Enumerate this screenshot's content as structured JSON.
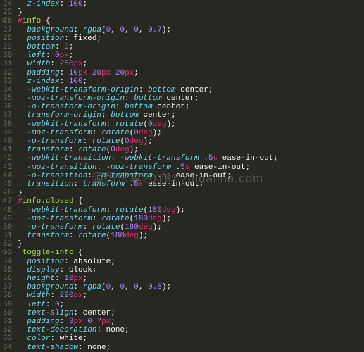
{
  "lines": [
    {
      "n": 24,
      "tokens": [
        [
          "  ",
          ""
        ],
        [
          "z-index",
          "prop"
        ],
        [
          ": ",
          "punct"
        ],
        [
          "100",
          "num"
        ],
        [
          ";",
          "punct"
        ]
      ]
    },
    {
      "n": 25,
      "tokens": [
        [
          "}",
          "punct"
        ]
      ]
    },
    {
      "n": 26,
      "fold": true,
      "tokens": [
        [
          "#",
          "hash"
        ],
        [
          "info",
          "selector"
        ],
        [
          " {",
          "punct"
        ]
      ]
    },
    {
      "n": 27,
      "tokens": [
        [
          "  ",
          ""
        ],
        [
          "background",
          "prop"
        ],
        [
          ": ",
          "punct"
        ],
        [
          "rgba",
          "func"
        ],
        [
          "(",
          "punct"
        ],
        [
          "0",
          "num"
        ],
        [
          ", ",
          "punct"
        ],
        [
          "0",
          "num"
        ],
        [
          ", ",
          "punct"
        ],
        [
          "0",
          "num"
        ],
        [
          ", ",
          "punct"
        ],
        [
          "0.7",
          "num"
        ],
        [
          ")",
          "punct"
        ],
        [
          ";",
          "punct"
        ]
      ]
    },
    {
      "n": 28,
      "tokens": [
        [
          "  ",
          ""
        ],
        [
          "position",
          "prop"
        ],
        [
          ": ",
          "punct"
        ],
        [
          "fixed",
          "ident"
        ],
        [
          ";",
          "punct"
        ]
      ]
    },
    {
      "n": 29,
      "tokens": [
        [
          "  ",
          ""
        ],
        [
          "bottom",
          "prop"
        ],
        [
          ": ",
          "punct"
        ],
        [
          "0",
          "num"
        ],
        [
          ";",
          "punct"
        ]
      ]
    },
    {
      "n": 30,
      "tokens": [
        [
          "  ",
          ""
        ],
        [
          "left",
          "prop"
        ],
        [
          ": ",
          "punct"
        ],
        [
          "0",
          "num"
        ],
        [
          "px",
          "unit"
        ],
        [
          ";",
          "punct"
        ]
      ]
    },
    {
      "n": 31,
      "tokens": [
        [
          "  ",
          ""
        ],
        [
          "width",
          "prop"
        ],
        [
          ": ",
          "punct"
        ],
        [
          "250",
          "num"
        ],
        [
          "px",
          "unit"
        ],
        [
          ";",
          "punct"
        ]
      ]
    },
    {
      "n": 32,
      "tokens": [
        [
          "  ",
          ""
        ],
        [
          "padding",
          "prop"
        ],
        [
          ": ",
          "punct"
        ],
        [
          "10",
          "num"
        ],
        [
          "px ",
          "unit"
        ],
        [
          "20",
          "num"
        ],
        [
          "px ",
          "unit"
        ],
        [
          "20",
          "num"
        ],
        [
          "px",
          "unit"
        ],
        [
          ";",
          "punct"
        ]
      ]
    },
    {
      "n": 33,
      "tokens": [
        [
          "  ",
          ""
        ],
        [
          "z-index",
          "prop"
        ],
        [
          ": ",
          "punct"
        ],
        [
          "100",
          "num"
        ],
        [
          ";",
          "punct"
        ]
      ]
    },
    {
      "n": 34,
      "tokens": [
        [
          "  ",
          ""
        ],
        [
          "-webkit-transform-origin",
          "prop"
        ],
        [
          ": ",
          "punct"
        ],
        [
          "bottom",
          "prop"
        ],
        [
          " center",
          "ident"
        ],
        [
          ";",
          "punct"
        ]
      ]
    },
    {
      "n": 35,
      "tokens": [
        [
          "  ",
          ""
        ],
        [
          "-moz-transform-origin",
          "prop"
        ],
        [
          ": ",
          "punct"
        ],
        [
          "bottom",
          "prop"
        ],
        [
          " center",
          "ident"
        ],
        [
          ";",
          "punct"
        ]
      ]
    },
    {
      "n": 36,
      "tokens": [
        [
          "  ",
          ""
        ],
        [
          "-o-transform-origin",
          "prop"
        ],
        [
          ": ",
          "punct"
        ],
        [
          "bottom",
          "prop"
        ],
        [
          " center",
          "ident"
        ],
        [
          ";",
          "punct"
        ]
      ]
    },
    {
      "n": 37,
      "tokens": [
        [
          "  ",
          ""
        ],
        [
          "transform-origin",
          "prop"
        ],
        [
          ": ",
          "punct"
        ],
        [
          "bottom",
          "prop"
        ],
        [
          " center",
          "ident"
        ],
        [
          ";",
          "punct"
        ]
      ]
    },
    {
      "n": 38,
      "tokens": [
        [
          "  ",
          ""
        ],
        [
          "-webkit-transform",
          "prop"
        ],
        [
          ": ",
          "punct"
        ],
        [
          "rotate",
          "func"
        ],
        [
          "(",
          "punct"
        ],
        [
          "0",
          "num"
        ],
        [
          "deg",
          "unit"
        ],
        [
          ")",
          "punct"
        ],
        [
          ";",
          "punct"
        ]
      ]
    },
    {
      "n": 39,
      "tokens": [
        [
          "  ",
          ""
        ],
        [
          "-moz-transform",
          "prop"
        ],
        [
          ": ",
          "punct"
        ],
        [
          "rotate",
          "func"
        ],
        [
          "(",
          "punct"
        ],
        [
          "0",
          "num"
        ],
        [
          "deg",
          "unit"
        ],
        [
          ")",
          "punct"
        ],
        [
          ";",
          "punct"
        ]
      ]
    },
    {
      "n": 40,
      "tokens": [
        [
          "  ",
          ""
        ],
        [
          "-o-transform",
          "prop"
        ],
        [
          ": ",
          "punct"
        ],
        [
          "rotate",
          "func"
        ],
        [
          "(",
          "punct"
        ],
        [
          "0",
          "num"
        ],
        [
          "deg",
          "unit"
        ],
        [
          ")",
          "punct"
        ],
        [
          ";",
          "punct"
        ]
      ]
    },
    {
      "n": 41,
      "tokens": [
        [
          "  ",
          ""
        ],
        [
          "transform",
          "prop"
        ],
        [
          ": ",
          "punct"
        ],
        [
          "rotate",
          "func"
        ],
        [
          "(",
          "punct"
        ],
        [
          "0",
          "num"
        ],
        [
          "deg",
          "unit"
        ],
        [
          ")",
          "punct"
        ],
        [
          ";",
          "punct"
        ]
      ]
    },
    {
      "n": 42,
      "tokens": [
        [
          "  ",
          ""
        ],
        [
          "-webkit-transition",
          "prop"
        ],
        [
          ": ",
          "punct"
        ],
        [
          "-webkit-transform",
          "prop"
        ],
        [
          " .",
          "punct"
        ],
        [
          "5",
          "num"
        ],
        [
          "s",
          "unit"
        ],
        [
          " ease-in-out",
          "ident"
        ],
        [
          ";",
          "punct"
        ]
      ]
    },
    {
      "n": 43,
      "tokens": [
        [
          "  ",
          ""
        ],
        [
          "-moz-transition",
          "prop"
        ],
        [
          ": ",
          "punct"
        ],
        [
          "-moz-transform",
          "prop"
        ],
        [
          " .",
          "punct"
        ],
        [
          "5",
          "num"
        ],
        [
          "s",
          "unit"
        ],
        [
          " ease-in-out",
          "ident"
        ],
        [
          ";",
          "punct"
        ]
      ]
    },
    {
      "n": 44,
      "tokens": [
        [
          "  ",
          ""
        ],
        [
          "-o-transition",
          "prop"
        ],
        [
          ": ",
          "punct"
        ],
        [
          "-o-transform",
          "prop"
        ],
        [
          " .",
          "punct"
        ],
        [
          "5",
          "num"
        ],
        [
          "s",
          "unit"
        ],
        [
          " ease-in-out",
          "ident"
        ],
        [
          ";",
          "punct"
        ]
      ]
    },
    {
      "n": 45,
      "tokens": [
        [
          "  ",
          ""
        ],
        [
          "transition",
          "prop"
        ],
        [
          ": ",
          "punct"
        ],
        [
          "transform",
          "prop"
        ],
        [
          " .",
          "punct"
        ],
        [
          "5",
          "num"
        ],
        [
          "s",
          "unit"
        ],
        [
          " ease-in-out",
          "ident"
        ],
        [
          ";",
          "punct"
        ]
      ]
    },
    {
      "n": 46,
      "tokens": [
        [
          "}",
          "punct"
        ]
      ]
    },
    {
      "n": 47,
      "fold": true,
      "tokens": [
        [
          "#",
          "hash"
        ],
        [
          "info.closed",
          "selector"
        ],
        [
          " {",
          "punct"
        ]
      ]
    },
    {
      "n": 48,
      "tokens": [
        [
          "  ",
          ""
        ],
        [
          "-webkit-transform",
          "prop"
        ],
        [
          ": ",
          "punct"
        ],
        [
          "rotate",
          "func"
        ],
        [
          "(",
          "punct"
        ],
        [
          "180",
          "num"
        ],
        [
          "deg",
          "unit"
        ],
        [
          ")",
          "punct"
        ],
        [
          ";",
          "punct"
        ]
      ]
    },
    {
      "n": 49,
      "tokens": [
        [
          "  ",
          ""
        ],
        [
          "-moz-transform",
          "prop"
        ],
        [
          ": ",
          "punct"
        ],
        [
          "rotate",
          "func"
        ],
        [
          "(",
          "punct"
        ],
        [
          "180",
          "num"
        ],
        [
          "deg",
          "unit"
        ],
        [
          ")",
          "punct"
        ],
        [
          ";",
          "punct"
        ]
      ]
    },
    {
      "n": 50,
      "tokens": [
        [
          "  ",
          ""
        ],
        [
          "-o-transform",
          "prop"
        ],
        [
          ": ",
          "punct"
        ],
        [
          "rotate",
          "func"
        ],
        [
          "(",
          "punct"
        ],
        [
          "180",
          "num"
        ],
        [
          "deg",
          "unit"
        ],
        [
          ")",
          "punct"
        ],
        [
          ";",
          "punct"
        ]
      ]
    },
    {
      "n": 51,
      "tokens": [
        [
          "  ",
          ""
        ],
        [
          "transform",
          "prop"
        ],
        [
          ": ",
          "punct"
        ],
        [
          "rotate",
          "func"
        ],
        [
          "(",
          "punct"
        ],
        [
          "180",
          "num"
        ],
        [
          "deg",
          "unit"
        ],
        [
          ")",
          "punct"
        ],
        [
          ";",
          "punct"
        ]
      ]
    },
    {
      "n": 52,
      "tokens": [
        [
          "}",
          "punct"
        ]
      ]
    },
    {
      "n": 53,
      "fold": true,
      "tokens": [
        [
          ".",
          "dot"
        ],
        [
          "toggle-info",
          "selector"
        ],
        [
          " {",
          "punct"
        ]
      ]
    },
    {
      "n": 54,
      "tokens": [
        [
          "  ",
          ""
        ],
        [
          "position",
          "prop"
        ],
        [
          ": ",
          "punct"
        ],
        [
          "absolute",
          "ident"
        ],
        [
          ";",
          "punct"
        ]
      ]
    },
    {
      "n": 55,
      "tokens": [
        [
          "  ",
          ""
        ],
        [
          "display",
          "prop"
        ],
        [
          ": ",
          "punct"
        ],
        [
          "block",
          "ident"
        ],
        [
          ";",
          "punct"
        ]
      ]
    },
    {
      "n": 56,
      "tokens": [
        [
          "  ",
          ""
        ],
        [
          "height",
          "prop"
        ],
        [
          ": ",
          "punct"
        ],
        [
          "10",
          "num"
        ],
        [
          "px",
          "unit"
        ],
        [
          ";",
          "punct"
        ]
      ]
    },
    {
      "n": 57,
      "tokens": [
        [
          "  ",
          ""
        ],
        [
          "background",
          "prop"
        ],
        [
          ": ",
          "punct"
        ],
        [
          "rgba",
          "func"
        ],
        [
          "(",
          "punct"
        ],
        [
          "0",
          "num"
        ],
        [
          ", ",
          "punct"
        ],
        [
          "0",
          "num"
        ],
        [
          ", ",
          "punct"
        ],
        [
          "0",
          "num"
        ],
        [
          ", ",
          "punct"
        ],
        [
          "0.8",
          "num"
        ],
        [
          ")",
          "punct"
        ],
        [
          ";",
          "punct"
        ]
      ]
    },
    {
      "n": 58,
      "tokens": [
        [
          "  ",
          ""
        ],
        [
          "width",
          "prop"
        ],
        [
          ": ",
          "punct"
        ],
        [
          "290",
          "num"
        ],
        [
          "px",
          "unit"
        ],
        [
          ";",
          "punct"
        ]
      ]
    },
    {
      "n": 59,
      "tokens": [
        [
          "  ",
          ""
        ],
        [
          "left",
          "prop"
        ],
        [
          ": ",
          "punct"
        ],
        [
          "0",
          "num"
        ],
        [
          ";",
          "punct"
        ]
      ]
    },
    {
      "n": 60,
      "tokens": [
        [
          "  ",
          ""
        ],
        [
          "text-align",
          "prop"
        ],
        [
          ": ",
          "punct"
        ],
        [
          "center",
          "ident"
        ],
        [
          ";",
          "punct"
        ]
      ]
    },
    {
      "n": 61,
      "tokens": [
        [
          "  ",
          ""
        ],
        [
          "padding",
          "prop"
        ],
        [
          ": ",
          "punct"
        ],
        [
          "3",
          "num"
        ],
        [
          "px ",
          "unit"
        ],
        [
          "0",
          "num"
        ],
        [
          " ",
          "punct"
        ],
        [
          "7",
          "num"
        ],
        [
          "px",
          "unit"
        ],
        [
          ";",
          "punct"
        ]
      ]
    },
    {
      "n": 62,
      "tokens": [
        [
          "  ",
          ""
        ],
        [
          "text-decoration",
          "prop"
        ],
        [
          ": ",
          "punct"
        ],
        [
          "none",
          "ident"
        ],
        [
          ";",
          "punct"
        ]
      ]
    },
    {
      "n": 63,
      "tokens": [
        [
          "  ",
          ""
        ],
        [
          "color",
          "prop"
        ],
        [
          ": ",
          "punct"
        ],
        [
          "white",
          "ident"
        ],
        [
          ";",
          "punct"
        ]
      ]
    },
    {
      "n": 64,
      "tokens": [
        [
          "  ",
          ""
        ],
        [
          "text-shadow",
          "prop"
        ],
        [
          ": ",
          "punct"
        ],
        [
          "none",
          "ident"
        ],
        [
          ";",
          "punct"
        ]
      ]
    }
  ],
  "watermark": "源码乐享2018©zuidaima.com"
}
